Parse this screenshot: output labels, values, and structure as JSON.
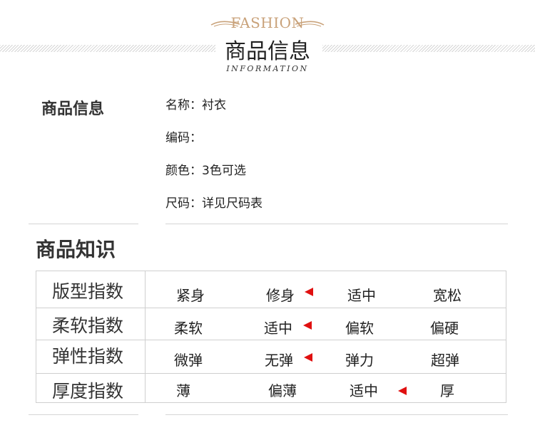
{
  "header": {
    "fashion": "FASHION",
    "title": "商品信息",
    "subtitle": "INFORMATION"
  },
  "info": {
    "heading": "商品信息",
    "rows": [
      "名称：衬衣",
      "编码：",
      "颜色：3色可选",
      "尺码：详见尺码表"
    ]
  },
  "knowledge": {
    "heading": "商品知识",
    "rows": [
      {
        "label": "版型指数",
        "options": [
          "紧身",
          "修身",
          "适中",
          "宽松"
        ],
        "selected": 1
      },
      {
        "label": "柔软指数",
        "options": [
          "柔软",
          "适中",
          "偏软",
          "偏硬"
        ],
        "selected": 1
      },
      {
        "label": "弹性指数",
        "options": [
          "微弹",
          "无弹",
          "弹力",
          "超弹"
        ],
        "selected": 1
      },
      {
        "label": "厚度指数",
        "options": [
          "薄",
          "偏薄",
          "适中",
          "厚"
        ],
        "selected": 2
      }
    ]
  },
  "colors": {
    "accent": "#c9a27a",
    "marker": "#e01010",
    "border": "#cfcfcf"
  }
}
